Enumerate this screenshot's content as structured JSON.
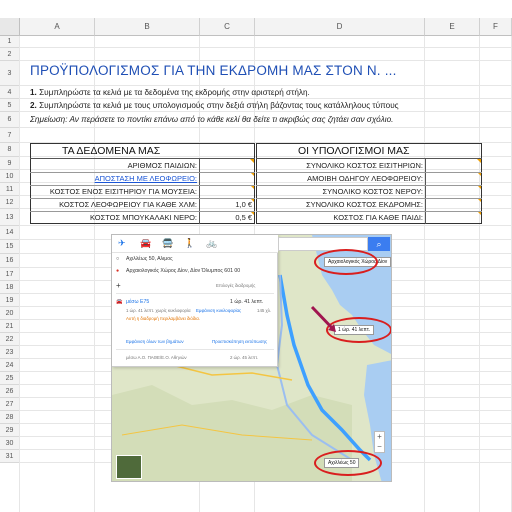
{
  "spreadsheet": {
    "columns": [
      "A",
      "B",
      "C",
      "D",
      "E",
      "F"
    ],
    "rows": [
      "1",
      "2",
      "3",
      "4",
      "5",
      "6",
      "7",
      "8",
      "9",
      "10",
      "11",
      "12",
      "13",
      "14",
      "15",
      "16",
      "17",
      "18",
      "19",
      "20",
      "21",
      "22",
      "23",
      "24",
      "25",
      "26",
      "27",
      "28",
      "29",
      "30",
      "31"
    ],
    "title": "ΠΡΟΫΠΟΛΟΓΙΣΜΟΣ ΓΙΑ ΤΗΝ ΕΚΔΡΟΜΗ ΜΑΣ ΣΤΟΝ Ν. ...",
    "instructions": [
      {
        "num": "1.",
        "text": " Συμπληρώστε τα κελιά με τα δεδομένα της εκδρομής στην αριστερή στήλη."
      },
      {
        "num": "2.",
        "text": " Συμπληρώστε τα κελιά με τους υπολογισμούς στην δεξιά στήλη βάζοντας τους κατάλληλους τύπους"
      }
    ],
    "note": "Σημείωση: Αν περάσετε το ποντίκι επάνω από το κάθε κελί θα δείτε τι ακριβώς σας ζητάει σαν σχόλιο.",
    "left_header": "ΤΑ ΔΕΔΟΜΕΝΑ ΜΑΣ",
    "right_header": "ΟΙ ΥΠΟΛΟΓΙΣΜΟΙ ΜΑΣ",
    "left_rows": [
      {
        "label": "ΑΡΙΘΜΟΣ ΠΑΙΔΙΩΝ:",
        "value": ""
      },
      {
        "label": "ΑΠΟΣΤΑΣΗ ΜΕ ΛΕΟΦΩΡΕΙΟ:",
        "value": ""
      },
      {
        "label": "ΚΟΣΤΟΣ ΕΝΟΣ ΕΙΣΙΤΗΡΙΟΥ ΓΙΑ ΜΟΥΣΕΙΑ:",
        "value": ""
      },
      {
        "label": "ΚΟΣΤΟΣ ΛΕΟΦΩΡΕΙΟΥ ΓΙΑ ΚΑΘΕ ΧΛΜ:",
        "value": "1,0 €"
      },
      {
        "label": "ΚΟΣΤΟΣ ΜΠΟΥΚΑΛΑΚΙ ΝΕΡΟ:",
        "value": "0,5 €"
      }
    ],
    "right_rows": [
      {
        "label": "ΣΥΝΟΛΙΚΟ ΚΟΣΤΟΣ ΕΙΣΙΤΗΡΙΩΝ:"
      },
      {
        "label": "ΑΜΟΙΒΗ ΟΔΗΓΟΥ ΛΕΟΦΩΡΕΙΟΥ:"
      },
      {
        "label": "ΣΥΝΟΛΙΚΟ ΚΟΣΤΟΣ ΝΕΡΟΥ:"
      },
      {
        "label": "ΣΥΝΟΛΙΚΟ ΚΟΣΤΟΣ ΕΚΔΡΟΜΗΣ:"
      },
      {
        "label": "ΚΟΣΤΟΣ ΓΙΑ ΚΑΘΕ ΠΑΙΔΙ:"
      }
    ]
  },
  "map": {
    "origin": "Αχιλλέως 50, Αλιμος",
    "destination": "Αρχαιολογικός Χώρος Δίον, Δίον Όλυμπος 601 00",
    "add_destination": "Επιλογές διαδρομής",
    "route1": {
      "via": "μέσω E75",
      "time": "1 ώρ. 41 λεπτ.",
      "detail": "1 ώρ. 41 λεπτ. χωρίς κυκλοφορία",
      "distance": "145 χλ.",
      "link": "Εμφάνιση κυκλοφορίας",
      "warning": "Αυτή η διαδρομή περιλαμβάνει διόδια."
    },
    "route1_steps": "Εμφάνιση όλων των βημάτων",
    "route1_print": "Προεπισκόπηση εκτύπωσης",
    "route2": {
      "via": "μέσω Α.Ο. ΠΑΘΕ/Ε.Ο. Αθηνών",
      "time": "2 ώρ. 45 λεπτ."
    },
    "callout_dest": "Αρχαιολογικός Χώρος Δίον",
    "callout_time": "1 ώρ. 41 λεπτ.",
    "callout_origin": "Αχιλλέως 50",
    "search_label": "search-icon",
    "zoom_in": "+",
    "zoom_out": "−"
  },
  "colors": {
    "title": "#1f4fb5",
    "link": "#1a55d6",
    "accent_ring": "#d91e1e",
    "route": "#3ea0ff",
    "comment_marker": "#f1a000"
  }
}
